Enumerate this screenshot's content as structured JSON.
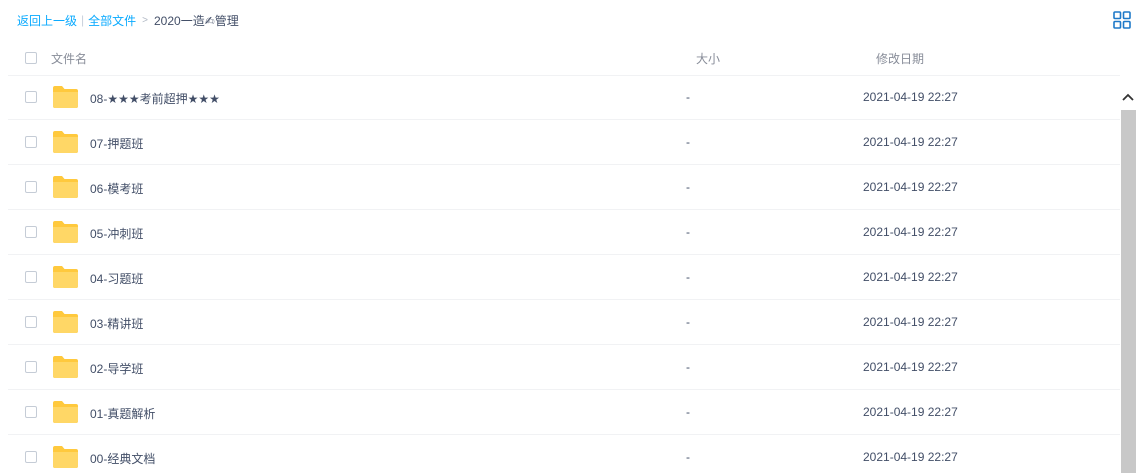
{
  "breadcrumb": {
    "back": "返回上一级",
    "separator": "|",
    "all_files": "全部文件",
    "arrow": ">",
    "current": "2020一造✍管理"
  },
  "header": {
    "name": "文件名",
    "size": "大小",
    "modified": "修改日期"
  },
  "files": [
    {
      "name": "08-★★★考前超押★★★",
      "size": "-",
      "date": "2021-04-19 22:27"
    },
    {
      "name": "07-押题班",
      "size": "-",
      "date": "2021-04-19 22:27"
    },
    {
      "name": "06-模考班",
      "size": "-",
      "date": "2021-04-19 22:27"
    },
    {
      "name": "05-冲刺班",
      "size": "-",
      "date": "2021-04-19 22:27"
    },
    {
      "name": "04-习题班",
      "size": "-",
      "date": "2021-04-19 22:27"
    },
    {
      "name": "03-精讲班",
      "size": "-",
      "date": "2021-04-19 22:27"
    },
    {
      "name": "02-导学班",
      "size": "-",
      "date": "2021-04-19 22:27"
    },
    {
      "name": "01-真题解析",
      "size": "-",
      "date": "2021-04-19 22:27"
    },
    {
      "name": "00-经典文档",
      "size": "-",
      "date": "2021-04-19 22:27"
    }
  ],
  "icons": {
    "view_toggle": "grid-view-icon",
    "folder": "folder-icon",
    "scroll_up": "chevron-up-icon"
  },
  "colors": {
    "link": "#09aaff",
    "folder": "#ffd766",
    "text": "#424e67"
  }
}
